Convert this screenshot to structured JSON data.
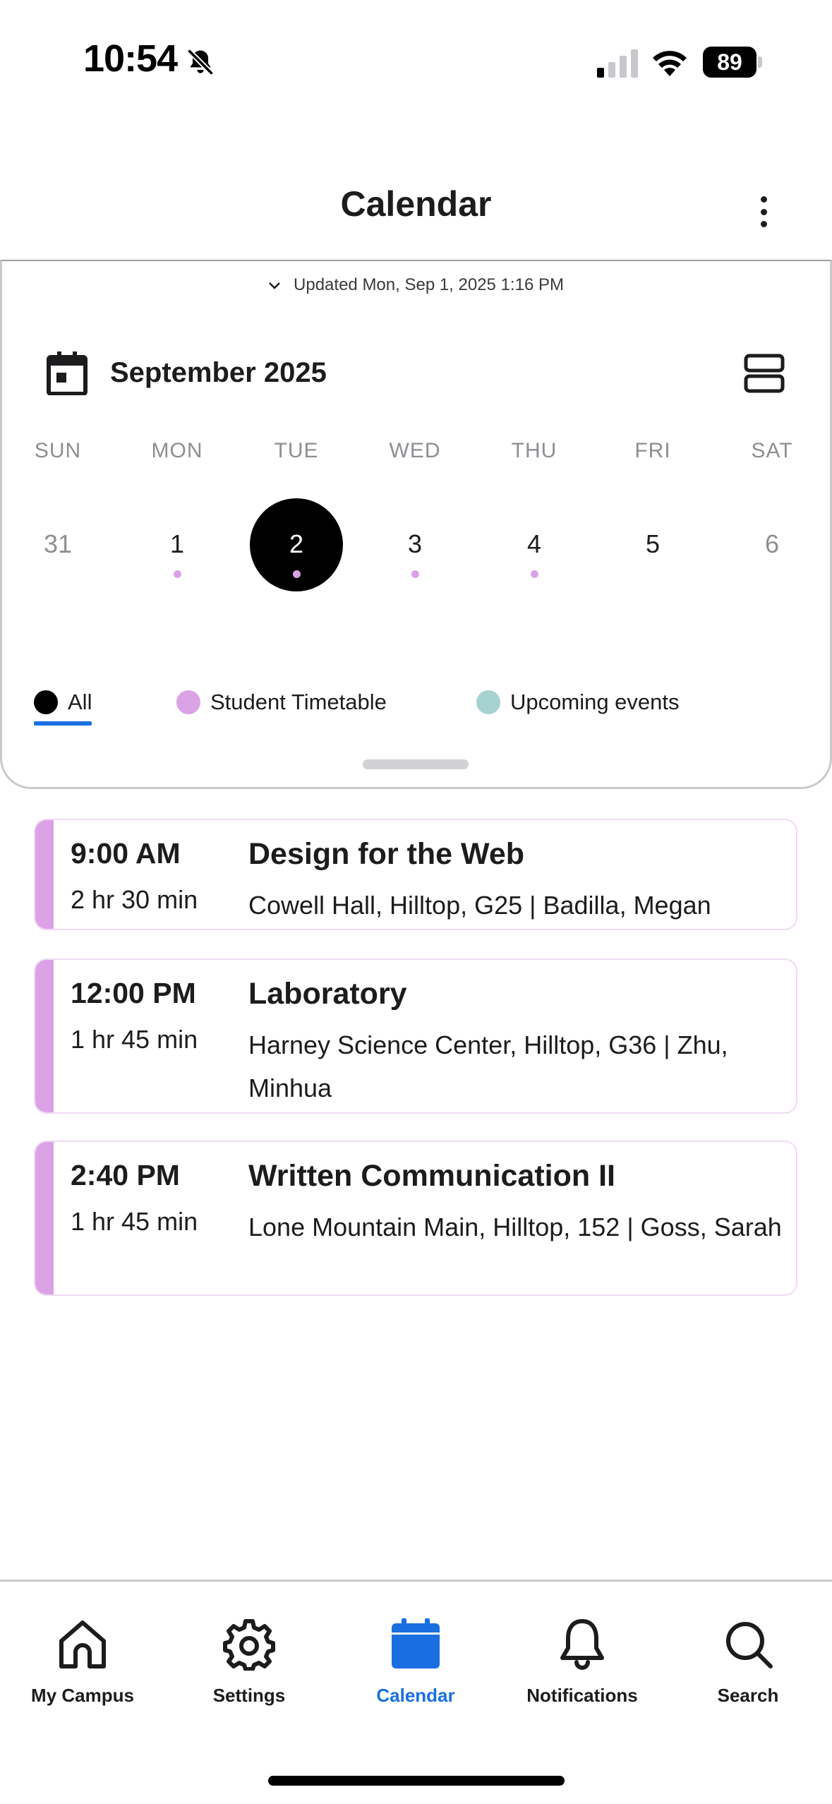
{
  "status_bar": {
    "time": "10:54",
    "battery": "89",
    "icons": [
      "bell-slash-icon",
      "cellular-signal-icon",
      "wifi-icon",
      "battery-icon"
    ]
  },
  "header": {
    "title": "Calendar",
    "menu_icon": "kebab-menu-icon"
  },
  "updated": {
    "text": "Updated Mon, Sep 1, 2025 1:16 PM"
  },
  "calendar": {
    "month_label": "September 2025",
    "weekdays": [
      "SUN",
      "MON",
      "TUE",
      "WED",
      "THU",
      "FRI",
      "SAT"
    ],
    "days": [
      {
        "number": "31",
        "muted": true,
        "has_event": false
      },
      {
        "number": "1",
        "muted": false,
        "has_event": true
      },
      {
        "number": "2",
        "muted": false,
        "has_event": true,
        "selected": true
      },
      {
        "number": "3",
        "muted": false,
        "has_event": true
      },
      {
        "number": "4",
        "muted": false,
        "has_event": true
      },
      {
        "number": "5",
        "muted": false,
        "has_event": false
      },
      {
        "number": "6",
        "muted": true,
        "has_event": false
      }
    ]
  },
  "filters": [
    {
      "label": "All",
      "color": "#000000",
      "active": true
    },
    {
      "label": "Student Timetable",
      "color": "#dca2e6",
      "active": false
    },
    {
      "label": "Upcoming events",
      "color": "#a6d3d0",
      "active": false
    }
  ],
  "events": [
    {
      "time": "9:00 AM",
      "duration": "2 hr 30 min",
      "title": "Design for the Web",
      "location": "Cowell Hall, Hilltop, G25 | Badilla, Megan",
      "color": "#dca2e6"
    },
    {
      "time": "12:00 PM",
      "duration": "1 hr 45 min",
      "title": "Laboratory",
      "location": "Harney Science Center, Hilltop, G36 | Zhu, Minhua",
      "color": "#dca2e6"
    },
    {
      "time": "2:40 PM",
      "duration": "1 hr 45 min",
      "title": "Written Communication II",
      "location": "Lone Mountain Main, Hilltop, 152 | Goss, Sarah",
      "color": "#dca2e6"
    }
  ],
  "tabbar": {
    "tabs": [
      {
        "label": "My Campus",
        "icon": "home-icon",
        "active": false
      },
      {
        "label": "Settings",
        "icon": "gear-icon",
        "active": false
      },
      {
        "label": "Calendar",
        "icon": "calendar-icon",
        "active": true
      },
      {
        "label": "Notifications",
        "icon": "bell-icon",
        "active": false
      },
      {
        "label": "Search",
        "icon": "search-icon",
        "active": false
      }
    ],
    "active_color": "#1a6fe0"
  }
}
